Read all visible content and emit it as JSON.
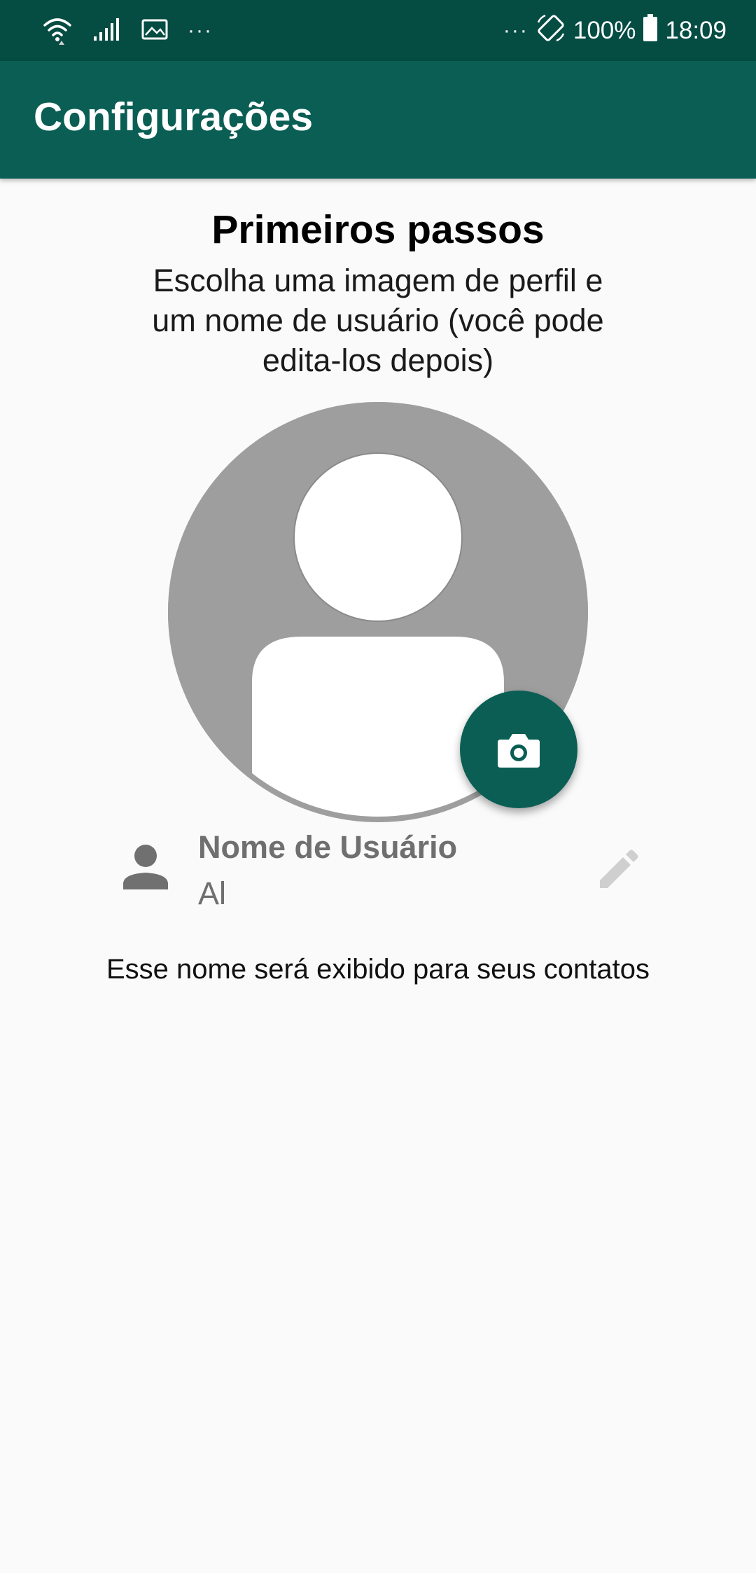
{
  "status_bar": {
    "left_icons": [
      "wifi-icon",
      "signal-icon",
      "gallery-icon"
    ],
    "left_more": "···",
    "right_more": "···",
    "battery_percent": "100%",
    "time": "18:09"
  },
  "app_bar": {
    "title": "Configurações"
  },
  "setup": {
    "heading": "Primeiros passos",
    "subtitle": "Escolha uma imagem de perfil e um nome de usuário (você pode edita-los depois)"
  },
  "avatar": {
    "icon": "default-avatar-icon",
    "action_icon": "camera-icon"
  },
  "username": {
    "label": "Nome de Usuário",
    "value": "Al",
    "leading_icon": "person-icon",
    "trailing_icon": "pencil-icon"
  },
  "helper_text": "Esse nome será exibido para seus contatos",
  "colors": {
    "status_bar": "#054c43",
    "app_bar": "#0a5e54",
    "accent": "#0a5e54",
    "avatar_bg": "#9e9e9e",
    "background": "#fafafa"
  }
}
